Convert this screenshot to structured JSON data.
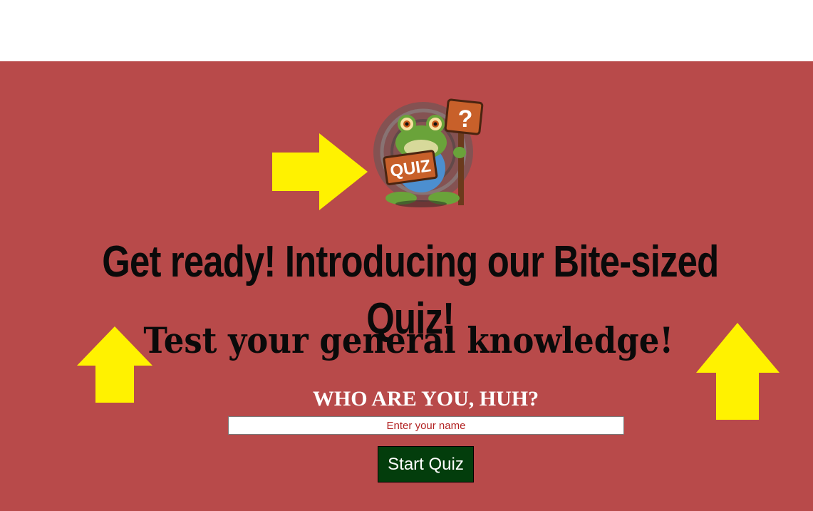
{
  "colors": {
    "background": "#b84a4a",
    "arrow": "#fff200",
    "button": "#033d0c",
    "placeholder": "#b22222"
  },
  "logo": {
    "badge_text": "QUIZ",
    "sign_text": "?"
  },
  "headline": "Get ready! Introducing our Bite-sized Quiz!",
  "subheadline": "Test your general knowledge!",
  "who_label": "WHO ARE YOU, HUH?",
  "name_input": {
    "placeholder": "Enter your name",
    "value": ""
  },
  "start_button": {
    "label": "Start Quiz"
  },
  "icons": [
    "frog-quiz-logo-icon",
    "arrow-right-icon",
    "arrow-up-icon"
  ]
}
